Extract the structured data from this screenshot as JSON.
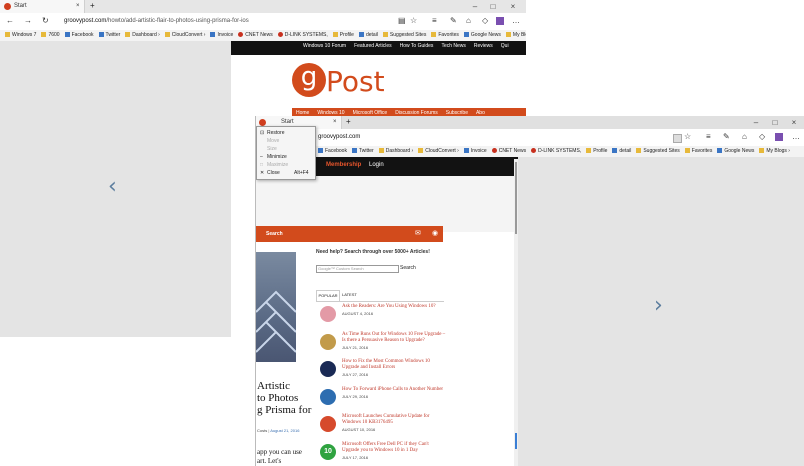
{
  "back_window": {
    "tab_label": "Start",
    "new_tab": "+",
    "url_host": "groovypost.com",
    "url_path": "/howto/add-artistic-flair-to-photos-using-prisma-for-ios",
    "favorites": [
      "Windows 7",
      "7600",
      "Facebook",
      "Twitter",
      "Dashboard ›",
      "CloudConvert ›",
      "Invoice",
      "CNET News",
      "D-LINK SYSTEMS,",
      "Profile",
      "detail",
      "Suggested Sites",
      "Favorites",
      "Google News",
      "My Blogs ›"
    ],
    "site_nav": [
      "Windows 10 Forum",
      "Featured Articles",
      "How To Guides",
      "Tech News",
      "Reviews",
      "Qui"
    ],
    "logo_g": "g",
    "logo_post": "Post",
    "red_nav": [
      "Home",
      "Windows 10",
      "Microsoft Office",
      "Discussion Forums",
      "Subscribe",
      "Abo"
    ]
  },
  "front_window": {
    "tab_label": "Start",
    "new_tab": "+",
    "url": "groovypost.com",
    "favorites": [
      "Facebook",
      "Twitter",
      "Dashboard ›",
      "CloudConvert ›",
      "Invoice",
      "CNET News",
      "D-LINK SYSTEMS,",
      "Profile",
      "detail",
      "Suggested Sites",
      "Favorites",
      "Google News",
      "My Blogs ›"
    ],
    "context_menu": [
      {
        "icon": "⊡",
        "label": "Restore",
        "shortcut": "",
        "disabled": false
      },
      {
        "icon": "",
        "label": "Move",
        "shortcut": "",
        "disabled": true
      },
      {
        "icon": "",
        "label": "Size",
        "shortcut": "",
        "disabled": true
      },
      {
        "icon": "–",
        "label": "Minimize",
        "shortcut": "",
        "disabled": false
      },
      {
        "icon": "□",
        "label": "Maximize",
        "shortcut": "",
        "disabled": true
      },
      {
        "icon": "✕",
        "label": "Close",
        "shortcut": "Alt+F4",
        "disabled": false
      }
    ],
    "top_links": {
      "membership": "Membership",
      "login": "Login"
    },
    "search_tab": "Search",
    "help_text": "Need help? Search through over 5000+ Articles!",
    "search_placeholder": "Google™ Custom Search",
    "search_button": "Search",
    "tabs": {
      "popular": "POPULAR",
      "latest": "LATEST"
    },
    "articles": [
      {
        "title": "Ask the Readers: Are You Using Windows 10?",
        "date": "AUGUST 4, 2016",
        "color": "#e39aa6"
      },
      {
        "title": "As Time Runs Out for Windows 10 Free Upgrade – Is there a Persuasive Reason to Upgrade?",
        "date": "JULY 21, 2016",
        "color": "#c29b4a"
      },
      {
        "title": "How to Fix the Most Common Windows 10 Upgrade and Install Errors",
        "date": "JULY 27, 2016",
        "color": "#1a2a55"
      },
      {
        "title": "How To Forward iPhone Calls to Another Number",
        "date": "JULY 29, 2016",
        "color": "#2d6db0"
      },
      {
        "title": "Microsoft Launches Cumulative Update for Windows 10 KB3176495",
        "date": "AUGUST 10, 2016",
        "color": "#d64a2c"
      },
      {
        "title": "Microsoft Offers Free Dell PC if they Can't Upgrade you to Windows 10 in 1 Day",
        "date": "JULY 17, 2016",
        "color": "#2fa340"
      }
    ],
    "article_heading": [
      "Artistic",
      "to Photos",
      "g Prisma for"
    ],
    "byline_author": "Costs",
    "byline_date": "August 21, 2016",
    "body_snippet": [
      "app you can use",
      "art. Let's"
    ],
    "badge_10": "10"
  }
}
